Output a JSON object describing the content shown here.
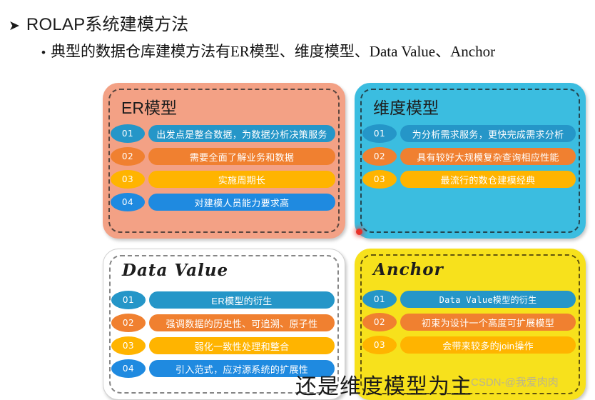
{
  "header": {
    "arrow_glyph": "➤",
    "heading": "ROLAP系统建模方法",
    "bullet_glyph": "•",
    "subheading": "典型的数据仓库建模方法有ER模型、维度模型、Data Value、Anchor"
  },
  "colors": {
    "panel_er_bg": "#f3a185",
    "panel_dim_bg": "#3bbde0",
    "panel_datavalue_bg": "#ffffff",
    "panel_anchor_bg": "#f7e11c",
    "row_teal": "#2596c8",
    "row_orange": "#f08030",
    "row_amber": "#ffb400",
    "row_blue": "#1f8ae0",
    "marker_red": "#e8322a",
    "watermark": "#b8b295"
  },
  "panels": [
    {
      "id": "er",
      "title": "ER模型",
      "title_style": "cjk",
      "rows": [
        {
          "num": "01",
          "text": "出发点是整合数据，为数据分析决策服务",
          "color": "#2596c8"
        },
        {
          "num": "02",
          "text": "需要全面了解业务和数据",
          "color": "#f08030"
        },
        {
          "num": "03",
          "text": "实施周期长",
          "color": "#ffb400"
        },
        {
          "num": "04",
          "text": "对建模人员能力要求高",
          "color": "#1f8ae0"
        }
      ]
    },
    {
      "id": "dim",
      "title": "维度模型",
      "title_style": "cjk",
      "rows": [
        {
          "num": "01",
          "text": "为分析需求服务，更快完成需求分析",
          "color": "#2596c8"
        },
        {
          "num": "02",
          "text": "具有较好大规模复杂查询相应性能",
          "color": "#f08030"
        },
        {
          "num": "03",
          "text": "最流行的数仓建模经典",
          "color": "#ffb400"
        }
      ]
    },
    {
      "id": "datavalue",
      "title": "Data Value",
      "title_style": "script",
      "rows": [
        {
          "num": "01",
          "text": "ER模型的衍生",
          "color": "#2596c8"
        },
        {
          "num": "02",
          "text": "强调数据的历史性、可追溯、原子性",
          "color": "#f08030"
        },
        {
          "num": "03",
          "text": "弱化一致性处理和整合",
          "color": "#ffb400"
        },
        {
          "num": "04",
          "text": "引入范式，应对源系统的扩展性",
          "color": "#1f8ae0"
        }
      ]
    },
    {
      "id": "anchor",
      "title": "Anchor",
      "title_style": "script",
      "rows": [
        {
          "num": "01",
          "text": "Data Value模型的衍生",
          "color": "#2596c8",
          "mono": true
        },
        {
          "num": "02",
          "text": "初束为设计一个高度可扩展模型",
          "color": "#f08030"
        },
        {
          "num": "03",
          "text": "会带来较多的join操作",
          "color": "#ffb400"
        }
      ]
    }
  ],
  "overlay": {
    "note": "还是维度模型为主",
    "watermark": "CSDN-@我爱肉肉"
  }
}
